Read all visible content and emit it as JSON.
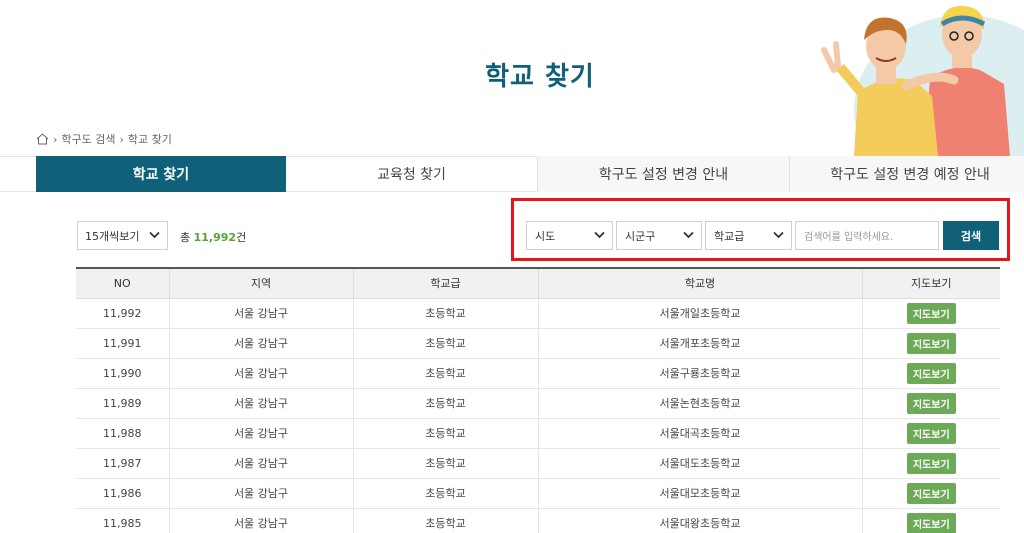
{
  "page": {
    "title": "학교 찾기"
  },
  "breadcrumb": {
    "items": [
      "학구도 검색",
      "학교 찾기"
    ],
    "separator": "›"
  },
  "tabs": [
    {
      "label": "학교 찾기",
      "active": true
    },
    {
      "label": "교육청 찾기",
      "active": false
    },
    {
      "label": "학구도 설정 변경 안내",
      "active": false
    },
    {
      "label": "학구도 설정 변경 예정 안내",
      "active": false
    }
  ],
  "toolbar": {
    "per_page": "15개씩보기",
    "total_prefix": "총",
    "total_count": "11,992",
    "total_suffix": "건"
  },
  "search": {
    "sido": "시도",
    "sigungu": "시군구",
    "school_level": "학교급",
    "placeholder": "검색어를 입력하세요.",
    "button": "검색"
  },
  "table": {
    "headers": [
      "NO",
      "지역",
      "학교급",
      "학교명",
      "지도보기"
    ],
    "rows": [
      {
        "no": "11,992",
        "region": "서울 강남구",
        "level": "초등학교",
        "name": "서울개일초등학교",
        "map": "지도보기"
      },
      {
        "no": "11,991",
        "region": "서울 강남구",
        "level": "초등학교",
        "name": "서울개포초등학교",
        "map": "지도보기"
      },
      {
        "no": "11,990",
        "region": "서울 강남구",
        "level": "초등학교",
        "name": "서울구룡초등학교",
        "map": "지도보기"
      },
      {
        "no": "11,989",
        "region": "서울 강남구",
        "level": "초등학교",
        "name": "서울논현초등학교",
        "map": "지도보기"
      },
      {
        "no": "11,988",
        "region": "서울 강남구",
        "level": "초등학교",
        "name": "서울대곡초등학교",
        "map": "지도보기"
      },
      {
        "no": "11,987",
        "region": "서울 강남구",
        "level": "초등학교",
        "name": "서울대도초등학교",
        "map": "지도보기"
      },
      {
        "no": "11,986",
        "region": "서울 강남구",
        "level": "초등학교",
        "name": "서울대모초등학교",
        "map": "지도보기"
      },
      {
        "no": "11,985",
        "region": "서울 강남구",
        "level": "초등학교",
        "name": "서울대왕초등학교",
        "map": "지도보기"
      }
    ]
  },
  "colors": {
    "accent": "#11607a",
    "count": "#59a332",
    "map_button": "#6daa57",
    "highlight": "#e8141b"
  }
}
